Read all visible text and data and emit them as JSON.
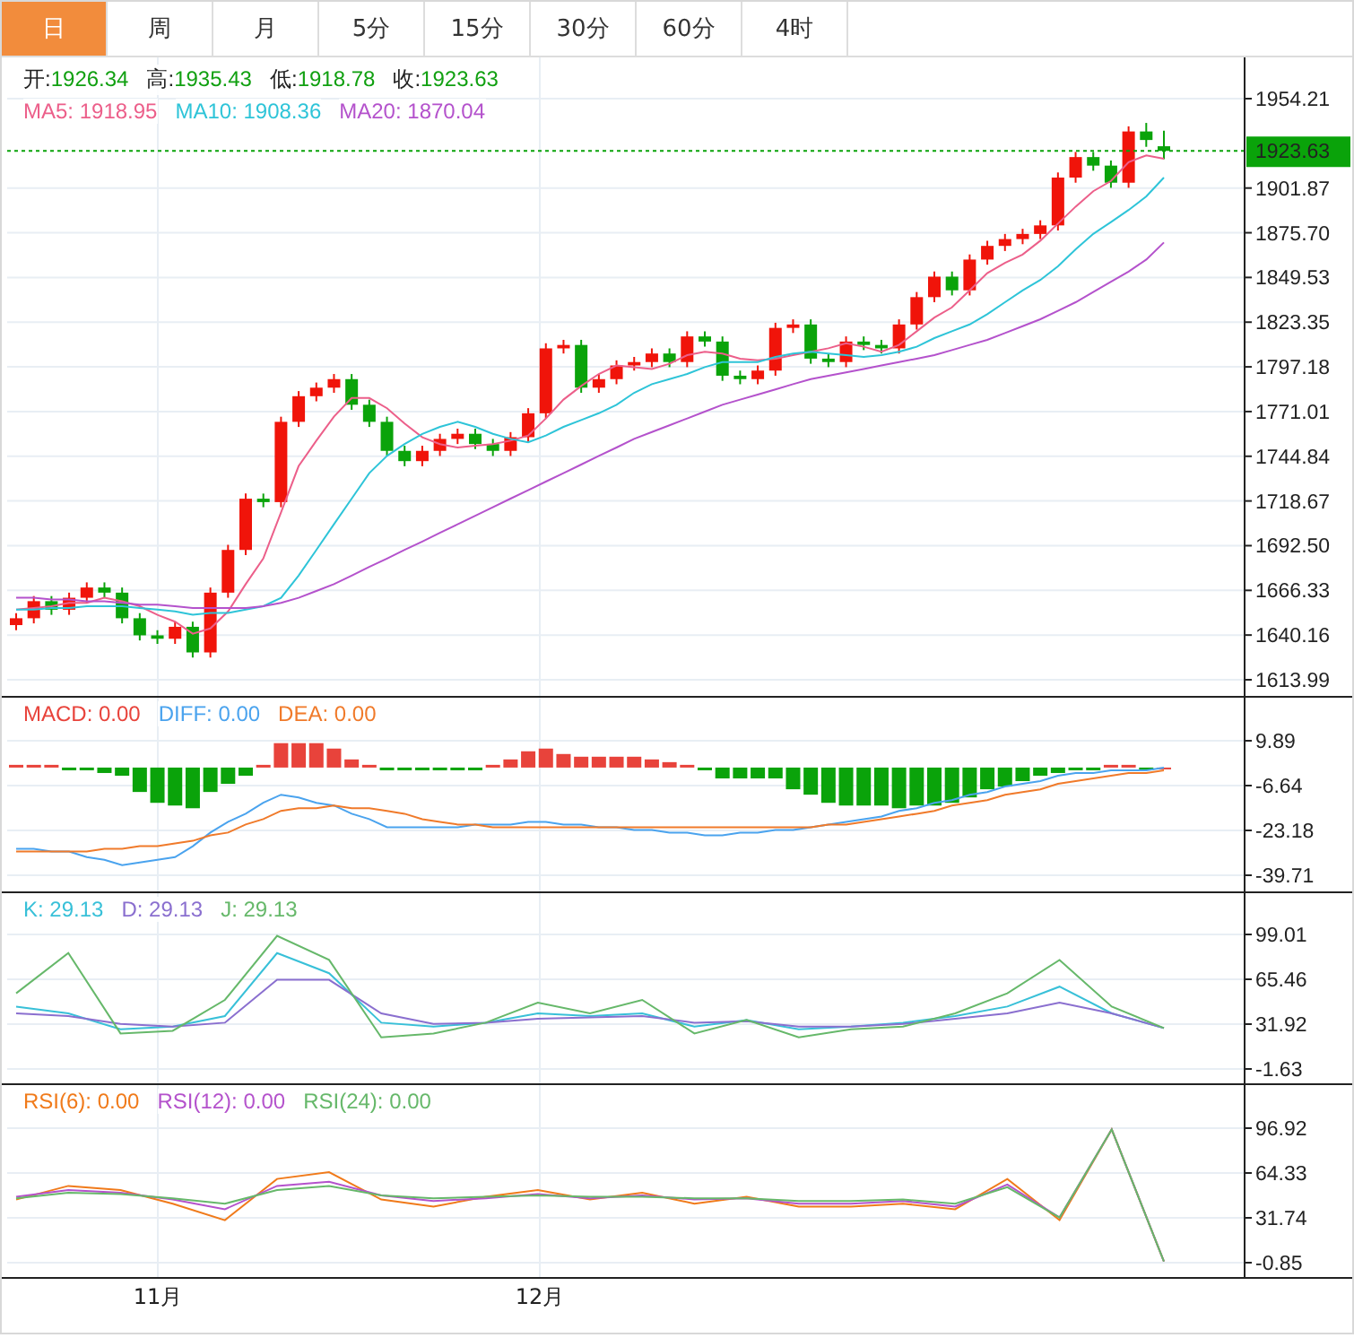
{
  "tabs": [
    {
      "label": "日",
      "selected": true
    },
    {
      "label": "周",
      "selected": false
    },
    {
      "label": "月",
      "selected": false
    },
    {
      "label": "5分",
      "selected": false
    },
    {
      "label": "15分",
      "selected": false
    },
    {
      "label": "30分",
      "selected": false
    },
    {
      "label": "60分",
      "selected": false
    },
    {
      "label": "4时",
      "selected": false
    }
  ],
  "price_panel": {
    "legend_ohlc": [
      {
        "label": "开:",
        "value": "1926.34"
      },
      {
        "label": "高:",
        "value": "1935.43"
      },
      {
        "label": "低:",
        "value": "1918.78"
      },
      {
        "label": "收:",
        "value": "1923.63"
      }
    ],
    "legend_ma": [
      {
        "text": "MA5: 1918.95",
        "color": "#ec5f8a"
      },
      {
        "text": "MA10: 1908.36",
        "color": "#2ec4d8"
      },
      {
        "text": "MA20: 1870.04",
        "color": "#b452cc"
      }
    ],
    "chart_data": {
      "type": "candlestick",
      "grid": true,
      "ylim": [
        1613.99,
        1954.21
      ],
      "yticks": [
        {
          "value": 1954.21,
          "label": "1954.21"
        },
        {
          "value": 1901.87,
          "label": "1901.87"
        },
        {
          "value": 1875.7,
          "label": "1875.70"
        },
        {
          "value": 1849.53,
          "label": "1849.53"
        },
        {
          "value": 1823.35,
          "label": "1823.35"
        },
        {
          "value": 1797.18,
          "label": "1797.18"
        },
        {
          "value": 1771.01,
          "label": "1771.01"
        },
        {
          "value": 1744.84,
          "label": "1744.84"
        },
        {
          "value": 1718.67,
          "label": "1718.67"
        },
        {
          "value": 1692.5,
          "label": "1692.50"
        },
        {
          "value": 1666.33,
          "label": "1666.33"
        },
        {
          "value": 1640.16,
          "label": "1640.16"
        },
        {
          "value": 1613.99,
          "label": "1613.99"
        }
      ],
      "ohlc": [
        [
          1646,
          1653,
          1643,
          1650
        ],
        [
          1650,
          1663,
          1647,
          1660
        ],
        [
          1660,
          1663,
          1652,
          1655
        ],
        [
          1655,
          1665,
          1652,
          1662
        ],
        [
          1662,
          1671,
          1659,
          1668
        ],
        [
          1668,
          1671,
          1662,
          1665
        ],
        [
          1665,
          1668,
          1647,
          1650
        ],
        [
          1650,
          1653,
          1637,
          1640
        ],
        [
          1640,
          1643,
          1635,
          1638
        ],
        [
          1638,
          1648,
          1635,
          1645
        ],
        [
          1645,
          1648,
          1627,
          1630
        ],
        [
          1630,
          1668,
          1627,
          1665
        ],
        [
          1665,
          1693,
          1662,
          1690
        ],
        [
          1690,
          1723,
          1687,
          1720
        ],
        [
          1720,
          1723,
          1715,
          1718
        ],
        [
          1718,
          1768,
          1715,
          1765
        ],
        [
          1765,
          1783,
          1762,
          1780
        ],
        [
          1780,
          1788,
          1777,
          1785
        ],
        [
          1785,
          1793,
          1782,
          1790
        ],
        [
          1790,
          1793,
          1772,
          1775
        ],
        [
          1775,
          1778,
          1762,
          1765
        ],
        [
          1765,
          1768,
          1745,
          1748
        ],
        [
          1748,
          1751,
          1739,
          1742
        ],
        [
          1742,
          1751,
          1739,
          1748
        ],
        [
          1748,
          1758,
          1745,
          1755
        ],
        [
          1755,
          1761,
          1752,
          1758
        ],
        [
          1758,
          1761,
          1749,
          1752
        ],
        [
          1752,
          1755,
          1745,
          1748
        ],
        [
          1748,
          1759,
          1745,
          1756
        ],
        [
          1756,
          1773,
          1753,
          1770
        ],
        [
          1770,
          1811,
          1767,
          1808
        ],
        [
          1808,
          1813,
          1805,
          1810
        ],
        [
          1810,
          1813,
          1782,
          1785
        ],
        [
          1785,
          1793,
          1782,
          1790
        ],
        [
          1790,
          1801,
          1787,
          1798
        ],
        [
          1798,
          1803,
          1795,
          1800
        ],
        [
          1800,
          1808,
          1797,
          1805
        ],
        [
          1805,
          1808,
          1797,
          1800
        ],
        [
          1800,
          1818,
          1797,
          1815
        ],
        [
          1815,
          1818,
          1809,
          1812
        ],
        [
          1812,
          1815,
          1789,
          1792
        ],
        [
          1792,
          1795,
          1787,
          1790
        ],
        [
          1790,
          1798,
          1787,
          1795
        ],
        [
          1795,
          1823,
          1792,
          1820
        ],
        [
          1820,
          1825,
          1817,
          1822
        ],
        [
          1822,
          1825,
          1799,
          1802
        ],
        [
          1802,
          1805,
          1797,
          1800
        ],
        [
          1800,
          1815,
          1797,
          1812
        ],
        [
          1812,
          1815,
          1807,
          1810
        ],
        [
          1810,
          1813,
          1805,
          1808
        ],
        [
          1808,
          1825,
          1805,
          1822
        ],
        [
          1822,
          1841,
          1819,
          1838
        ],
        [
          1838,
          1853,
          1835,
          1850
        ],
        [
          1850,
          1853,
          1839,
          1842
        ],
        [
          1842,
          1863,
          1839,
          1860
        ],
        [
          1860,
          1871,
          1857,
          1868
        ],
        [
          1868,
          1875,
          1865,
          1872
        ],
        [
          1872,
          1878,
          1869,
          1875
        ],
        [
          1875,
          1883,
          1872,
          1880
        ],
        [
          1880,
          1911,
          1877,
          1908
        ],
        [
          1908,
          1923,
          1905,
          1920
        ],
        [
          1920,
          1923,
          1912,
          1915
        ],
        [
          1915,
          1918,
          1902,
          1905
        ],
        [
          1905,
          1938,
          1902,
          1935
        ],
        [
          1935,
          1940,
          1926,
          1930
        ],
        [
          1926.34,
          1935.43,
          1918.78,
          1923.63
        ]
      ],
      "ref_lines": [
        {
          "value": 1923.63,
          "axis": "y",
          "color": "#0aa30a",
          "label": "1923.63"
        }
      ],
      "series": [
        {
          "type": "line",
          "color": "#ec5f8a",
          "values": [
            1655,
            1656,
            1657,
            1659,
            1659,
            1662,
            1660,
            1657,
            1652,
            1648,
            1641,
            1644,
            1654,
            1670,
            1685,
            1712,
            1739,
            1754,
            1768,
            1779,
            1779,
            1773,
            1764,
            1756,
            1752,
            1750,
            1751,
            1752,
            1754,
            1757,
            1767,
            1778,
            1786,
            1793,
            1798,
            1797,
            1796,
            1799,
            1804,
            1806,
            1805,
            1802,
            1801,
            1802,
            1804,
            1806,
            1808,
            1811,
            1809,
            1806,
            1810,
            1818,
            1826,
            1832,
            1842,
            1852,
            1858,
            1863,
            1871,
            1881,
            1891,
            1900,
            1906,
            1917,
            1921,
            1919
          ]
        },
        {
          "type": "line",
          "color": "#2ec4d8",
          "values": [
            1655,
            1655,
            1656,
            1656,
            1657,
            1657,
            1657,
            1656,
            1655,
            1654,
            1652,
            1653,
            1653,
            1655,
            1657,
            1662,
            1675,
            1690,
            1705,
            1720,
            1735,
            1745,
            1752,
            1758,
            1762,
            1765,
            1762,
            1758,
            1755,
            1753,
            1757,
            1762,
            1766,
            1770,
            1775,
            1782,
            1787,
            1790,
            1793,
            1797,
            1800,
            1800,
            1800,
            1803,
            1805,
            1806,
            1805,
            1804,
            1803,
            1804,
            1806,
            1809,
            1814,
            1818,
            1822,
            1828,
            1835,
            1842,
            1848,
            1856,
            1866,
            1875,
            1882,
            1889,
            1897,
            1908
          ]
        },
        {
          "type": "line",
          "color": "#b452cc",
          "values": [
            1662,
            1662,
            1661,
            1661,
            1660,
            1660,
            1659,
            1658,
            1658,
            1657,
            1656,
            1656,
            1656,
            1656,
            1657,
            1659,
            1662,
            1666,
            1670,
            1675,
            1680,
            1685,
            1690,
            1695,
            1700,
            1705,
            1710,
            1715,
            1720,
            1725,
            1730,
            1735,
            1740,
            1745,
            1750,
            1755,
            1759,
            1763,
            1767,
            1771,
            1775,
            1778,
            1781,
            1784,
            1787,
            1790,
            1792,
            1794,
            1796,
            1798,
            1800,
            1802,
            1804,
            1807,
            1810,
            1813,
            1817,
            1821,
            1825,
            1830,
            1835,
            1841,
            1847,
            1853,
            1860,
            1870
          ]
        }
      ]
    }
  },
  "macd_panel": {
    "legend": [
      {
        "text": "MACD: 0.00",
        "color": "#e8433b"
      },
      {
        "text": "DIFF: 0.00",
        "color": "#4aa3ee"
      },
      {
        "text": "DEA: 0.00",
        "color": "#f07a2a"
      }
    ],
    "chart_data": {
      "type": "line",
      "grid": true,
      "ylim": [
        -39.71,
        9.89
      ],
      "yticks": [
        {
          "value": 9.89,
          "label": "9.89"
        },
        {
          "value": -6.64,
          "label": "-6.64"
        },
        {
          "value": -23.18,
          "label": "-23.18"
        },
        {
          "value": -39.71,
          "label": "-39.71"
        }
      ],
      "series": [
        {
          "type": "bar",
          "color": "#e8433b",
          "values": [
            1,
            1,
            1,
            null,
            null,
            null,
            null,
            null,
            null,
            null,
            null,
            null,
            null,
            null,
            1,
            9,
            9,
            9,
            7,
            3,
            1,
            null,
            null,
            null,
            null,
            null,
            null,
            1,
            3,
            6,
            7,
            5,
            4,
            4,
            4,
            4,
            3,
            2,
            1,
            null,
            null,
            null,
            null,
            null,
            null,
            null,
            null,
            null,
            null,
            null,
            null,
            null,
            null,
            null,
            null,
            null,
            null,
            null,
            null,
            null,
            null,
            null,
            1,
            1,
            null,
            0
          ]
        },
        {
          "type": "bar",
          "color": "#0aa30a",
          "values": [
            null,
            null,
            null,
            -1,
            -1,
            -2,
            -3,
            -9,
            -13,
            -14,
            -15,
            -9,
            -6,
            -3,
            null,
            null,
            null,
            null,
            null,
            null,
            null,
            -1,
            -1,
            -1,
            -1,
            -1,
            -1,
            null,
            null,
            null,
            null,
            null,
            null,
            null,
            null,
            null,
            null,
            null,
            null,
            -1,
            -4,
            -4,
            -4,
            -4,
            -8,
            -10,
            -13,
            -14,
            -14,
            -14,
            -15,
            -14,
            -14,
            -13,
            -11,
            -8,
            -7,
            -5,
            -3,
            -2,
            -1,
            -1,
            null,
            null,
            -1,
            null
          ]
        },
        {
          "color": "#4aa3ee",
          "values": [
            -30,
            -30,
            -31,
            -31,
            -33,
            -34,
            -36,
            -35,
            -34,
            -33,
            -29,
            -24,
            -20,
            -17,
            -13,
            -10,
            -11,
            -13,
            -14,
            -17,
            -19,
            -22,
            -22,
            -22,
            -22,
            -22,
            -21,
            -21,
            -21,
            -20,
            -20,
            -21,
            -21,
            -22,
            -22,
            -23,
            -23,
            -24,
            -24,
            -25,
            -25,
            -24,
            -24,
            -23,
            -23,
            -22,
            -21,
            -20,
            -19,
            -18,
            -16,
            -15,
            -13,
            -12,
            -10,
            -9,
            -7,
            -6,
            -5,
            -3,
            -2,
            -2,
            -1,
            -1,
            -1,
            0
          ]
        },
        {
          "color": "#f07a2a",
          "values": [
            -31,
            -31,
            -31,
            -31,
            -31,
            -30,
            -30,
            -29,
            -29,
            -28,
            -27,
            -25,
            -24,
            -21,
            -19,
            -16,
            -15,
            -15,
            -14,
            -15,
            -15,
            -16,
            -17,
            -19,
            -20,
            -21,
            -21,
            -22,
            -22,
            -22,
            -22,
            -22,
            -22,
            -22,
            -22,
            -22,
            -22,
            -22,
            -22,
            -22,
            -22,
            -22,
            -22,
            -22,
            -22,
            -22,
            -21,
            -21,
            -20,
            -19,
            -18,
            -17,
            -16,
            -14,
            -13,
            -12,
            -10,
            -9,
            -8,
            -6,
            -5,
            -4,
            -3,
            -2,
            -2,
            -1
          ]
        }
      ]
    }
  },
  "kdj_panel": {
    "legend": [
      {
        "text": "K: 29.13",
        "color": "#38c0d8"
      },
      {
        "text": "D: 29.13",
        "color": "#8a6fcf"
      },
      {
        "text": "J: 29.13",
        "color": "#66b86a"
      }
    ],
    "chart_data": {
      "type": "line",
      "grid": true,
      "ylim": [
        -1.63,
        99.01
      ],
      "yticks": [
        {
          "value": 99.01,
          "label": "99.01"
        },
        {
          "value": 65.46,
          "label": "65.46"
        },
        {
          "value": 31.92,
          "label": "31.92"
        },
        {
          "value": -1.63,
          "label": "-1.63"
        }
      ],
      "series": [
        {
          "color": "#38c0d8",
          "values": [
            45,
            40,
            28,
            30,
            38,
            85,
            70,
            33,
            30,
            33,
            40,
            38,
            40,
            30,
            35,
            28,
            30,
            33,
            38,
            45,
            60,
            40,
            29
          ]
        },
        {
          "color": "#8a6fcf",
          "values": [
            40,
            38,
            32,
            30,
            33,
            65,
            65,
            40,
            32,
            33,
            36,
            37,
            38,
            33,
            34,
            30,
            30,
            32,
            36,
            40,
            48,
            40,
            29
          ]
        },
        {
          "color": "#66b86a",
          "values": [
            55,
            85,
            25,
            27,
            50,
            98,
            80,
            22,
            25,
            33,
            48,
            40,
            50,
            25,
            35,
            22,
            28,
            30,
            40,
            55,
            80,
            45,
            29
          ]
        }
      ]
    }
  },
  "rsi_panel": {
    "legend": [
      {
        "text": "RSI(6): 0.00",
        "color": "#f07a1a"
      },
      {
        "text": "RSI(12): 0.00",
        "color": "#b452cc"
      },
      {
        "text": "RSI(24): 0.00",
        "color": "#66b86a"
      }
    ],
    "chart_data": {
      "type": "line",
      "grid": true,
      "ylim": [
        -0.85,
        96.92
      ],
      "yticks": [
        {
          "value": 96.92,
          "label": "96.92"
        },
        {
          "value": 64.33,
          "label": "64.33"
        },
        {
          "value": 31.74,
          "label": "31.74"
        },
        {
          "value": -0.85,
          "label": "-0.85"
        }
      ],
      "series": [
        {
          "color": "#f07a1a",
          "values": [
            45,
            55,
            52,
            42,
            30,
            60,
            65,
            45,
            40,
            47,
            52,
            45,
            50,
            42,
            47,
            40,
            40,
            42,
            38,
            60,
            30,
            96,
            0
          ]
        },
        {
          "color": "#b452cc",
          "values": [
            47,
            52,
            50,
            45,
            38,
            55,
            58,
            48,
            44,
            46,
            49,
            46,
            48,
            45,
            46,
            42,
            42,
            44,
            40,
            56,
            32,
            96,
            0
          ]
        },
        {
          "color": "#66b86a",
          "values": [
            46,
            50,
            49,
            46,
            42,
            52,
            55,
            48,
            46,
            47,
            48,
            47,
            47,
            46,
            46,
            44,
            44,
            45,
            42,
            54,
            32,
            96,
            0
          ]
        }
      ]
    }
  },
  "xaxis": {
    "labels": [
      "11月",
      "12月"
    ]
  }
}
